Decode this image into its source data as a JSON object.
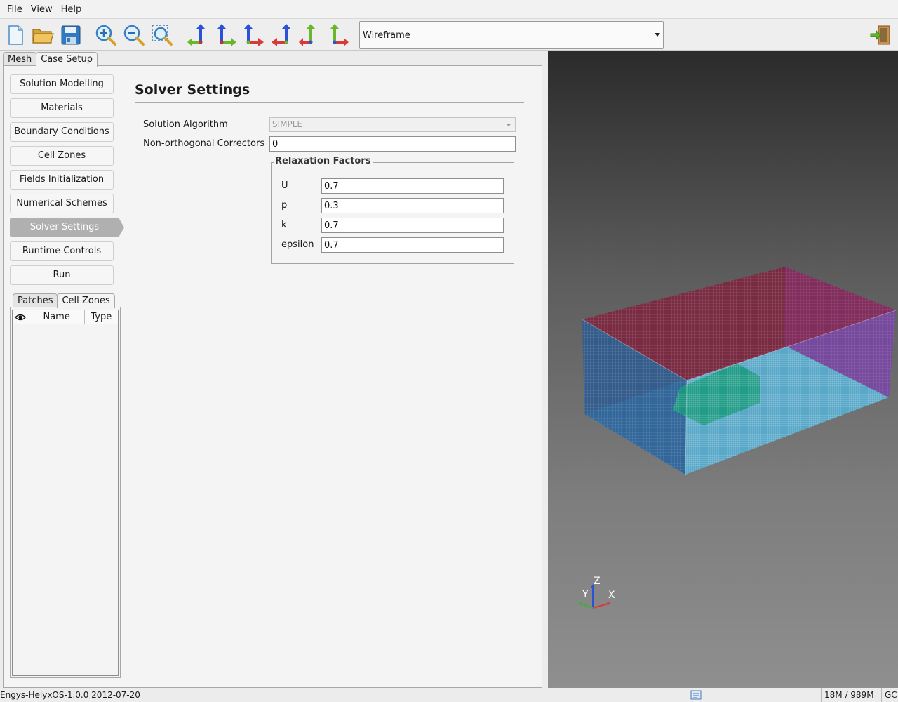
{
  "menu": {
    "items": [
      "File",
      "View",
      "Help"
    ]
  },
  "toolbar": {
    "icons": [
      "new-file-icon",
      "open-folder-icon",
      "save-icon",
      "zoom-in-icon",
      "zoom-out-icon",
      "zoom-fit-icon",
      "view-minus-x-icon",
      "view-plus-x-icon",
      "view-minus-y-icon",
      "view-plus-y-icon",
      "view-minus-z-icon",
      "view-plus-z-icon"
    ],
    "render_mode": "Wireframe",
    "exit_icon": "exit-door-icon"
  },
  "main_tabs": [
    "Mesh",
    "Case Setup"
  ],
  "active_main_tab": "Case Setup",
  "nav": {
    "items": [
      "Solution Modelling",
      "Materials",
      "Boundary Conditions",
      "Cell Zones",
      "Fields Initialization",
      "Numerical Schemes",
      "Solver Settings",
      "Runtime Controls",
      "Run"
    ],
    "active": "Solver Settings"
  },
  "sub_tabs": [
    "Patches",
    "Cell Zones"
  ],
  "active_sub_tab": "Cell Zones",
  "patch_table": {
    "columns": [
      "Name",
      "Type"
    ],
    "visibility_icon": "eye-icon"
  },
  "solver": {
    "title": "Solver Settings",
    "algorithm_label": "Solution Algorithm",
    "algorithm_value": "SIMPLE",
    "correctors_label": "Non-orthogonal Correctors",
    "correctors_value": "0",
    "relaxation_title": "Relaxation Factors",
    "factors": [
      {
        "label": "U",
        "value": "0.7"
      },
      {
        "label": "p",
        "value": "0.3"
      },
      {
        "label": "k",
        "value": "0.7"
      },
      {
        "label": "epsilon",
        "value": "0.7"
      }
    ]
  },
  "viewport": {
    "axes": {
      "z": "Z",
      "y": "Y",
      "x": "X"
    },
    "colors": {
      "top": "#7a2840",
      "left": "#2a5a90",
      "right": "#8a3aa0",
      "floor": "#5aa8c8",
      "block": "#1a9a80"
    }
  },
  "status": {
    "version": "Engys-HelyxOS-1.0.0 2012-07-20",
    "memory": "18M / 989M",
    "gc": "GC"
  }
}
